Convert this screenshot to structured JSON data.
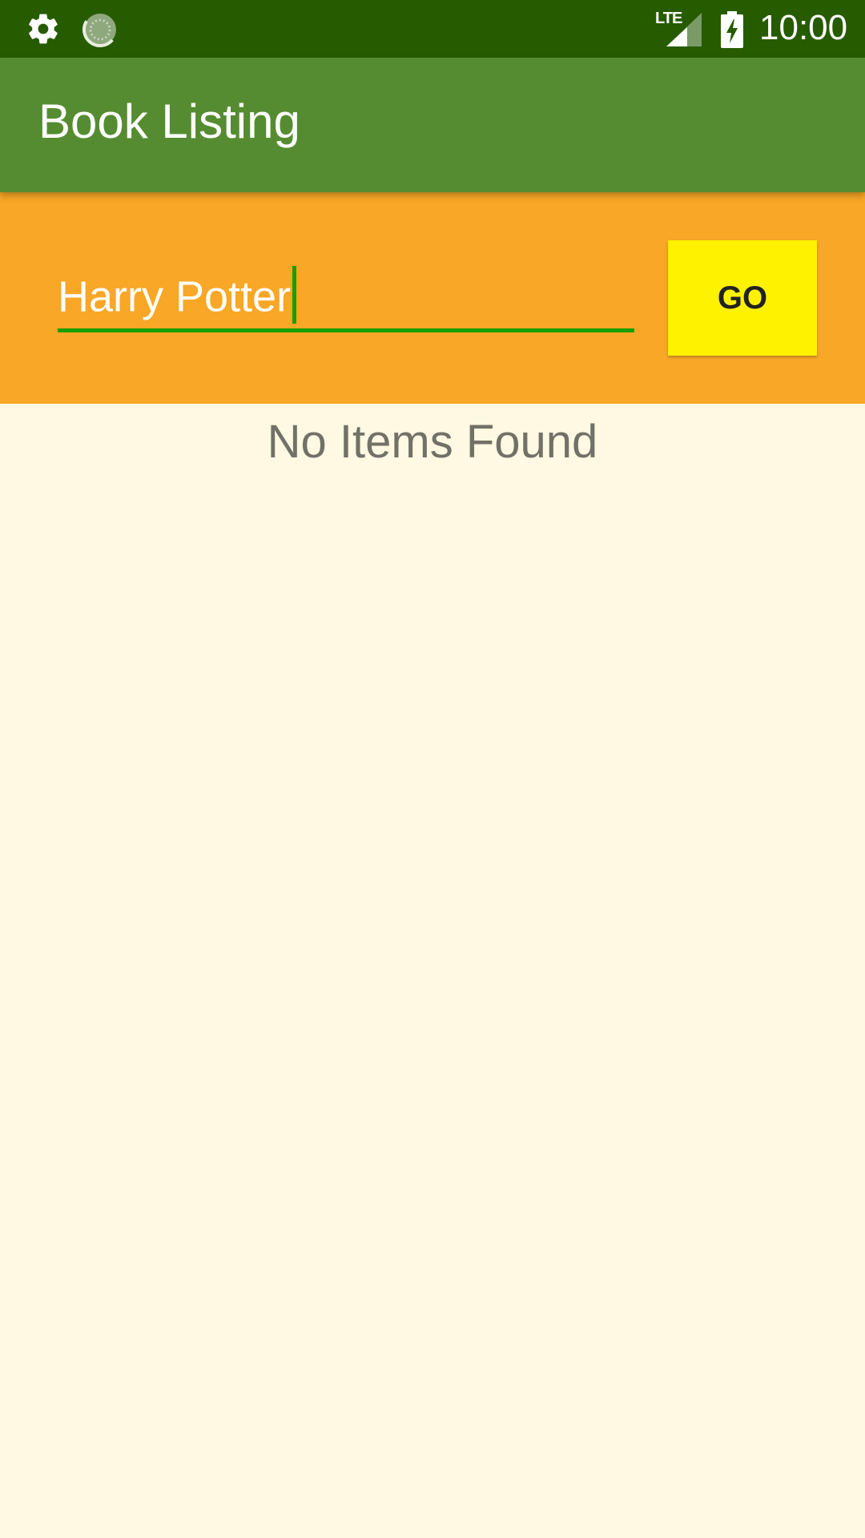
{
  "status_bar": {
    "time": "10:00",
    "network": "LTE",
    "icons": [
      "gear-icon",
      "sync-spinner-icon",
      "signal-icon",
      "battery-charging-icon"
    ]
  },
  "app_bar": {
    "title": "Book Listing",
    "color": "#568C31"
  },
  "search": {
    "query": "Harry Potter",
    "go_label": "GO",
    "panel_color": "#F8A726",
    "button_color": "#FFF200",
    "underline_color": "#1A9E00"
  },
  "results": {
    "empty_message": "No Items Found"
  }
}
